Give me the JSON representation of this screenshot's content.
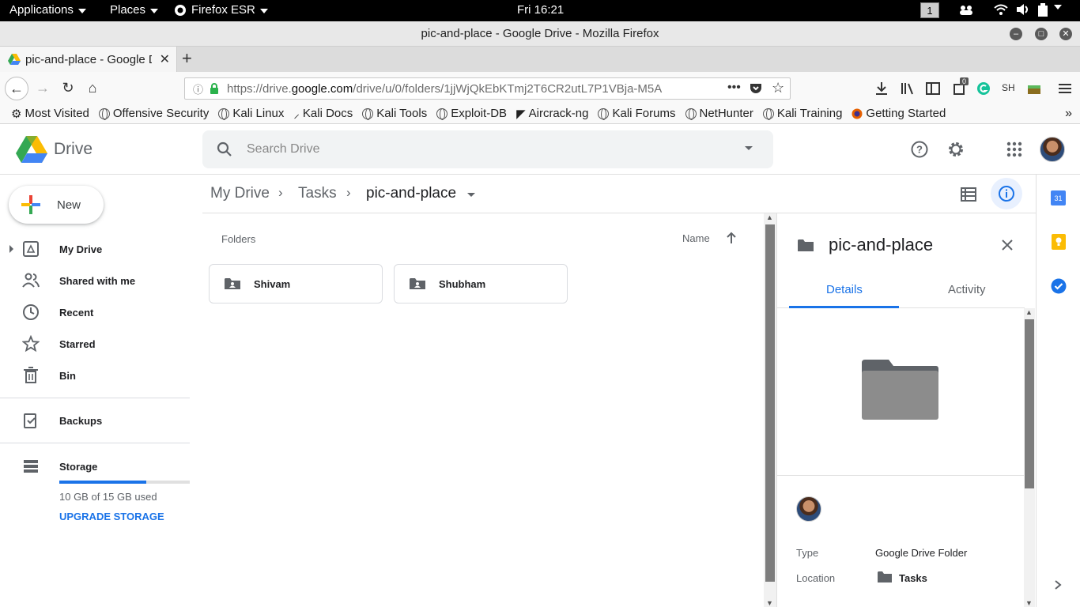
{
  "os": {
    "applications": "Applications",
    "places": "Places",
    "browser_menu": "Firefox ESR",
    "clock": "Fri 16:21",
    "workspace": "1"
  },
  "window": {
    "title": "pic-and-place - Google Drive - Mozilla Firefox"
  },
  "tab": {
    "title": "pic-and-place - Google D",
    "close": "✕",
    "new_tab": "+"
  },
  "url": {
    "prefix": "https://drive.",
    "domain": "google.com",
    "path": "/drive/u/0/folders/1jjWjQkEbKTmj2T6CR2utL7P1VBja-M5A"
  },
  "toolbar": {
    "badge_count": "0",
    "profile_initials": "SH"
  },
  "bookmarks": [
    "Most Visited",
    "Offensive Security",
    "Kali Linux",
    "Kali Docs",
    "Kali Tools",
    "Exploit-DB",
    "Aircrack-ng",
    "Kali Forums",
    "NetHunter",
    "Kali Training",
    "Getting Started"
  ],
  "drive": {
    "app_name": "Drive",
    "search_placeholder": "Search Drive",
    "new_button": "New",
    "nav": {
      "my_drive": "My Drive",
      "shared": "Shared with me",
      "recent": "Recent",
      "starred": "Starred",
      "bin": "Bin",
      "backups": "Backups",
      "storage": "Storage"
    },
    "storage": {
      "used_text": "10 GB of 15 GB used",
      "used_fraction": 0.667,
      "upgrade": "UPGRADE STORAGE"
    },
    "breadcrumb": {
      "root": "My Drive",
      "parent": "Tasks",
      "current": "pic-and-place"
    },
    "section_label": "Folders",
    "sort_label": "Name",
    "folders": [
      "Shivam",
      "Shubham"
    ],
    "details": {
      "title": "pic-and-place",
      "tab_details": "Details",
      "tab_activity": "Activity",
      "type_label": "Type",
      "type_value": "Google Drive Folder",
      "location_label": "Location",
      "location_value": "Tasks"
    },
    "addons": {
      "calendar_day": "31"
    }
  },
  "colors": {
    "accent_blue": "#1a73e8",
    "os_bar": "#000000",
    "folder_gray": "#5f6368"
  }
}
